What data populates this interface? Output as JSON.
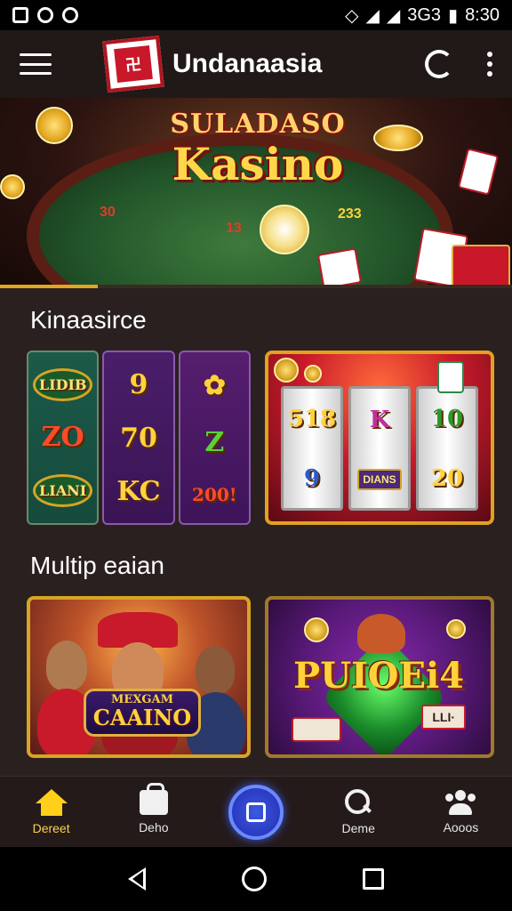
{
  "status_bar": {
    "signal_text": "3G3",
    "time": "8:30"
  },
  "app_bar": {
    "title": "Undanaasia"
  },
  "hero": {
    "title_line1": "SULADASO",
    "title_line2": "Kasino",
    "chip_numbers": [
      "30",
      "13",
      "233"
    ]
  },
  "section1": {
    "title": "Kinaasirce",
    "slot_left": {
      "col1": [
        "LIDIB",
        "ZO",
        "LIANI"
      ],
      "col2": [
        "9",
        "70",
        "KC"
      ],
      "col3": [
        "Z",
        "200!"
      ]
    },
    "slot_right": {
      "reel1": [
        "518",
        "9"
      ],
      "reel2": [
        "K",
        "DIANS"
      ],
      "reel3": [
        "10",
        "20"
      ]
    }
  },
  "section2": {
    "title": "Multip eaian",
    "card_left": {
      "banner_small": "MEXGAM",
      "banner_big": "CAAINO"
    },
    "card_right": {
      "big_word": "PUIOEi4",
      "tag": "LLI·"
    }
  },
  "bottom_nav": {
    "items": [
      {
        "label": "Dereet",
        "icon": "home-icon",
        "active": true
      },
      {
        "label": "Deho",
        "icon": "bag-icon",
        "active": false
      },
      {
        "label": "",
        "icon": "center-icon",
        "active": false
      },
      {
        "label": "Deme",
        "icon": "search-icon",
        "active": false
      },
      {
        "label": "Aooos",
        "icon": "people-icon",
        "active": false
      }
    ]
  },
  "colors": {
    "accent_gold": "#ffcf1a",
    "center_button": "#2a3ac0",
    "background": "#2b2020"
  }
}
